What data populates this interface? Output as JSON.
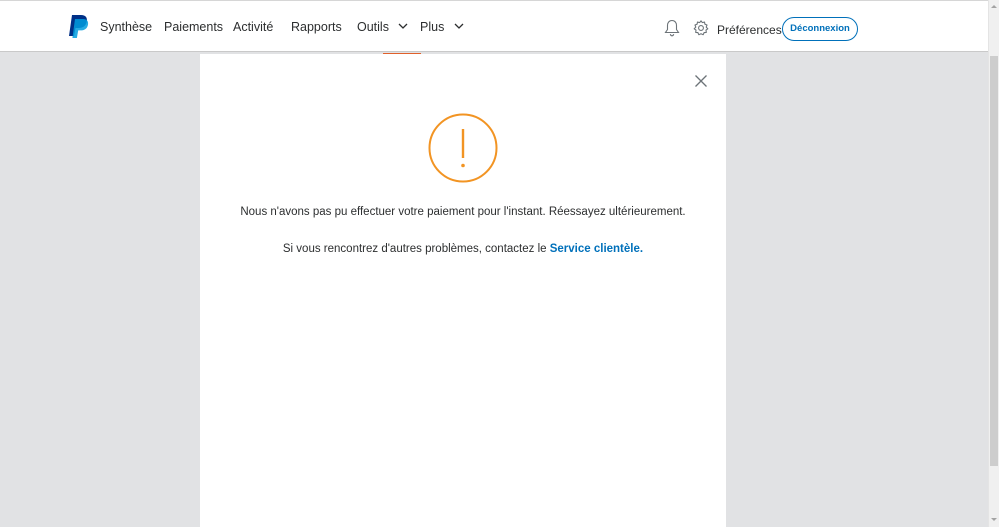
{
  "header": {
    "logo": "paypal-logo",
    "nav": [
      {
        "label": "Synthèse"
      },
      {
        "label": "Paiements"
      },
      {
        "label": "Activité"
      },
      {
        "label": "Rapports"
      },
      {
        "label": "Outils",
        "icon": "chevron-down-icon"
      },
      {
        "label": "Plus",
        "icon": "chevron-down-icon"
      }
    ],
    "notifications_icon": "bell-icon",
    "settings_icon": "gear-icon",
    "preferences_label": "Préférences",
    "logout_label": "Déconnexion"
  },
  "modal": {
    "close_icon": "close-icon",
    "status_icon": "warning-icon",
    "message": "Nous n'avons pas pu effectuer votre paiement pour l'instant. Réessayez ultérieurement.",
    "help_prefix": "Si vous rencontrez d'autres problèmes, contactez le ",
    "help_link": "Service clientèle",
    "help_suffix": "."
  },
  "colors": {
    "brand_blue": "#0070ba",
    "warning_orange": "#f29423",
    "background": "#e1e2e4"
  }
}
